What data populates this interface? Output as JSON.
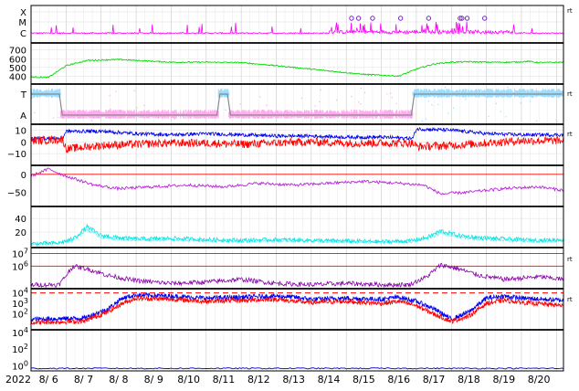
{
  "chart_data": {
    "type": "line",
    "title": "",
    "x_axis": {
      "year_label": "2022",
      "tick_labels": [
        "8/ 6",
        "8/ 7",
        "8/ 8",
        "8/ 9",
        "8/10",
        "8/11",
        "8/12",
        "8/13",
        "8/14",
        "8/15",
        "8/16",
        "8/17",
        "8/18",
        "8/19",
        "8/20"
      ],
      "range_days": [
        0,
        15.2
      ]
    },
    "colors": {
      "magenta": "#ff00ff",
      "green": "#00dd00",
      "light_blue": "#99ddff",
      "pink": "#ffaaee",
      "blue": "#0000ee",
      "red": "#ff0000",
      "purple": "#bb22dd",
      "cyan": "#00e5e5",
      "dark_purple": "#8800aa",
      "navy": "#0000cc",
      "gray": "#888888"
    },
    "panels": [
      {
        "id": "flare",
        "tick_labels": [
          "X",
          "M",
          "C"
        ],
        "right_label": "rt",
        "series": [
          {
            "color_key": "magenta",
            "baseline_level": "C"
          }
        ],
        "flare_markers_day": [
          9.15,
          9.35,
          9.75,
          10.55,
          11.35,
          12.25,
          12.3,
          12.45,
          12.95
        ]
      },
      {
        "id": "speed",
        "tick_labels": [
          "700",
          "600",
          "500",
          "400"
        ],
        "ylim": [
          330,
          760
        ],
        "series": [
          {
            "color_key": "green",
            "x_days": [
              0,
              0.5,
              1.0,
              1.6,
              2.5,
              4,
              5,
              6,
              7,
              8,
              9,
              9.5,
              10,
              10.5,
              11.0,
              11.5,
              12,
              12.5,
              13.0,
              13.8,
              14.2,
              14.5,
              15.2
            ],
            "values": [
              390,
              385,
              520,
              580,
              590,
              560,
              560,
              555,
              520,
              480,
              440,
              420,
              410,
              400,
              480,
              540,
              560,
              565,
              560,
              560,
              570,
              555,
              560
            ]
          }
        ]
      },
      {
        "id": "polarity",
        "tick_labels": [
          "T",
          "A"
        ],
        "right_label": "rt",
        "polarity_segments": [
          {
            "start": 0.0,
            "end": 0.85,
            "state": "T"
          },
          {
            "start": 0.85,
            "end": 5.35,
            "state": "A"
          },
          {
            "start": 5.35,
            "end": 5.65,
            "state": "T"
          },
          {
            "start": 5.65,
            "end": 10.9,
            "state": "A"
          },
          {
            "start": 10.9,
            "end": 15.2,
            "state": "T"
          }
        ]
      },
      {
        "id": "bfield",
        "tick_labels": [
          "10",
          "0",
          "−10"
        ],
        "right_label": "rt",
        "ylim": [
          -20,
          15
        ],
        "series": [
          {
            "color_key": "blue",
            "x_days": [
              0,
              0.9,
              1.0,
              2,
              3,
              4,
              5,
              6,
              7,
              8,
              9,
              10,
              10.9,
              11.0,
              12,
              13,
              14,
              15.2
            ],
            "values": [
              3,
              3,
              9,
              9,
              7,
              6,
              7,
              6,
              5,
              5,
              4,
              4,
              3,
              11,
              10,
              7,
              6,
              6
            ]
          },
          {
            "color_key": "red",
            "x_days": [
              0,
              0.9,
              1.0,
              2,
              3,
              4,
              5,
              6,
              7,
              8,
              9,
              10,
              10.9,
              11.0,
              12,
              13,
              14,
              15.2
            ],
            "values": [
              1,
              2,
              -6,
              -3,
              -2,
              -1,
              -1,
              -2,
              -1,
              0,
              -1,
              -1,
              -1,
              -4,
              -3,
              -1,
              1,
              1
            ]
          }
        ]
      },
      {
        "id": "theta",
        "tick_labels": [
          "0",
          "−50"
        ],
        "ylim": [
          -90,
          25
        ],
        "reference_line": 0,
        "series": [
          {
            "color_key": "purple",
            "x_days": [
              0,
              0.5,
              1,
              1.8,
              2.5,
              3.5,
              4.5,
              5.5,
              6.5,
              7.5,
              8.5,
              9.5,
              10.5,
              11.2,
              11.7,
              12.5,
              13.5,
              14.5,
              15.2
            ],
            "values": [
              -5,
              15,
              -5,
              -30,
              -40,
              -35,
              -30,
              -35,
              -25,
              -30,
              -25,
              -20,
              -25,
              -30,
              -55,
              -50,
              -40,
              -35,
              -45
            ]
          }
        ]
      },
      {
        "id": "density",
        "tick_labels": [
          "40",
          "20"
        ],
        "ylim": [
          0,
          55
        ],
        "series": [
          {
            "color_key": "cyan",
            "x_days": [
              0,
              0.8,
              1.2,
              1.6,
              2.0,
              2.5,
              3,
              4,
              5,
              6,
              7,
              8,
              9,
              10,
              10.8,
              11.3,
              11.7,
              12.2,
              12.8,
              13.5,
              14.5,
              15.2
            ],
            "values": [
              3,
              4,
              10,
              28,
              15,
              12,
              10,
              11,
              9,
              8,
              9,
              8,
              7,
              6,
              7,
              12,
              22,
              15,
              12,
              10,
              8,
              9
            ]
          }
        ]
      },
      {
        "id": "temperature",
        "tick_labels": [
          "10^7",
          "10^6"
        ],
        "right_label": "rt",
        "ylim_log10": [
          4.3,
          7.4
        ],
        "reference_lines_log10": [
          6.95,
          6.0
        ],
        "series": [
          {
            "color_key": "dark_purple",
            "x_days": [
              0,
              0.8,
              1.2,
              1.6,
              2.2,
              3.0,
              4,
              5,
              6,
              7,
              8,
              9,
              10,
              10.8,
              11.3,
              11.7,
              12.2,
              12.8,
              13.5,
              14.5,
              15.2
            ],
            "values_log10": [
              4.6,
              4.6,
              6.0,
              5.8,
              5.3,
              4.9,
              4.7,
              4.8,
              5.0,
              4.7,
              4.6,
              4.7,
              4.6,
              4.6,
              5.2,
              6.1,
              5.8,
              5.3,
              5.0,
              5.2,
              5.0
            ]
          }
        ]
      },
      {
        "id": "proton_flux",
        "tick_labels": [
          "10^4",
          "10^3",
          "10^2"
        ],
        "right_label": "rt",
        "ylim_log10": [
          0.5,
          4.4
        ],
        "threshold_log10": 4.0,
        "series": [
          {
            "color_key": "blue",
            "x_days": [
              0,
              1.5,
              2.2,
              2.6,
              3.0,
              4,
              5,
              6,
              7,
              7.5,
              8,
              9,
              10,
              10.5,
              11,
              11.5,
              12,
              12.5,
              13,
              13.5,
              14,
              15.2
            ],
            "values_log10": [
              1.5,
              1.6,
              2.5,
              3.5,
              3.8,
              3.7,
              3.5,
              3.6,
              3.7,
              3.6,
              3.4,
              3.5,
              3.4,
              3.6,
              3.2,
              2.5,
              1.5,
              2.2,
              3.5,
              3.7,
              3.5,
              3.3
            ]
          },
          {
            "color_key": "red",
            "x_days": [
              0,
              1.5,
              2.2,
              2.6,
              3.0,
              4,
              5,
              6,
              7,
              7.5,
              8,
              9,
              10,
              10.5,
              11,
              11.5,
              12,
              12.5,
              13,
              13.5,
              14,
              15.2
            ],
            "values_log10": [
              1.2,
              1.3,
              2.2,
              3.0,
              3.5,
              3.4,
              3.2,
              3.3,
              3.4,
              3.2,
              3.1,
              3.2,
              3.0,
              3.2,
              2.8,
              2.0,
              1.3,
              1.8,
              3.0,
              3.3,
              3.1,
              2.8
            ]
          }
        ]
      },
      {
        "id": "electron_flux",
        "tick_labels": [
          "10^4",
          "10^2",
          "10^0"
        ],
        "ylim_log10": [
          -0.6,
          4.3
        ],
        "series": [
          {
            "color_key": "navy",
            "x_days": [
              0,
              3,
              6,
              9,
              12,
              15.2
            ],
            "values_log10": [
              -0.3,
              -0.3,
              -0.3,
              -0.3,
              -0.3,
              -0.3
            ]
          }
        ]
      }
    ]
  }
}
